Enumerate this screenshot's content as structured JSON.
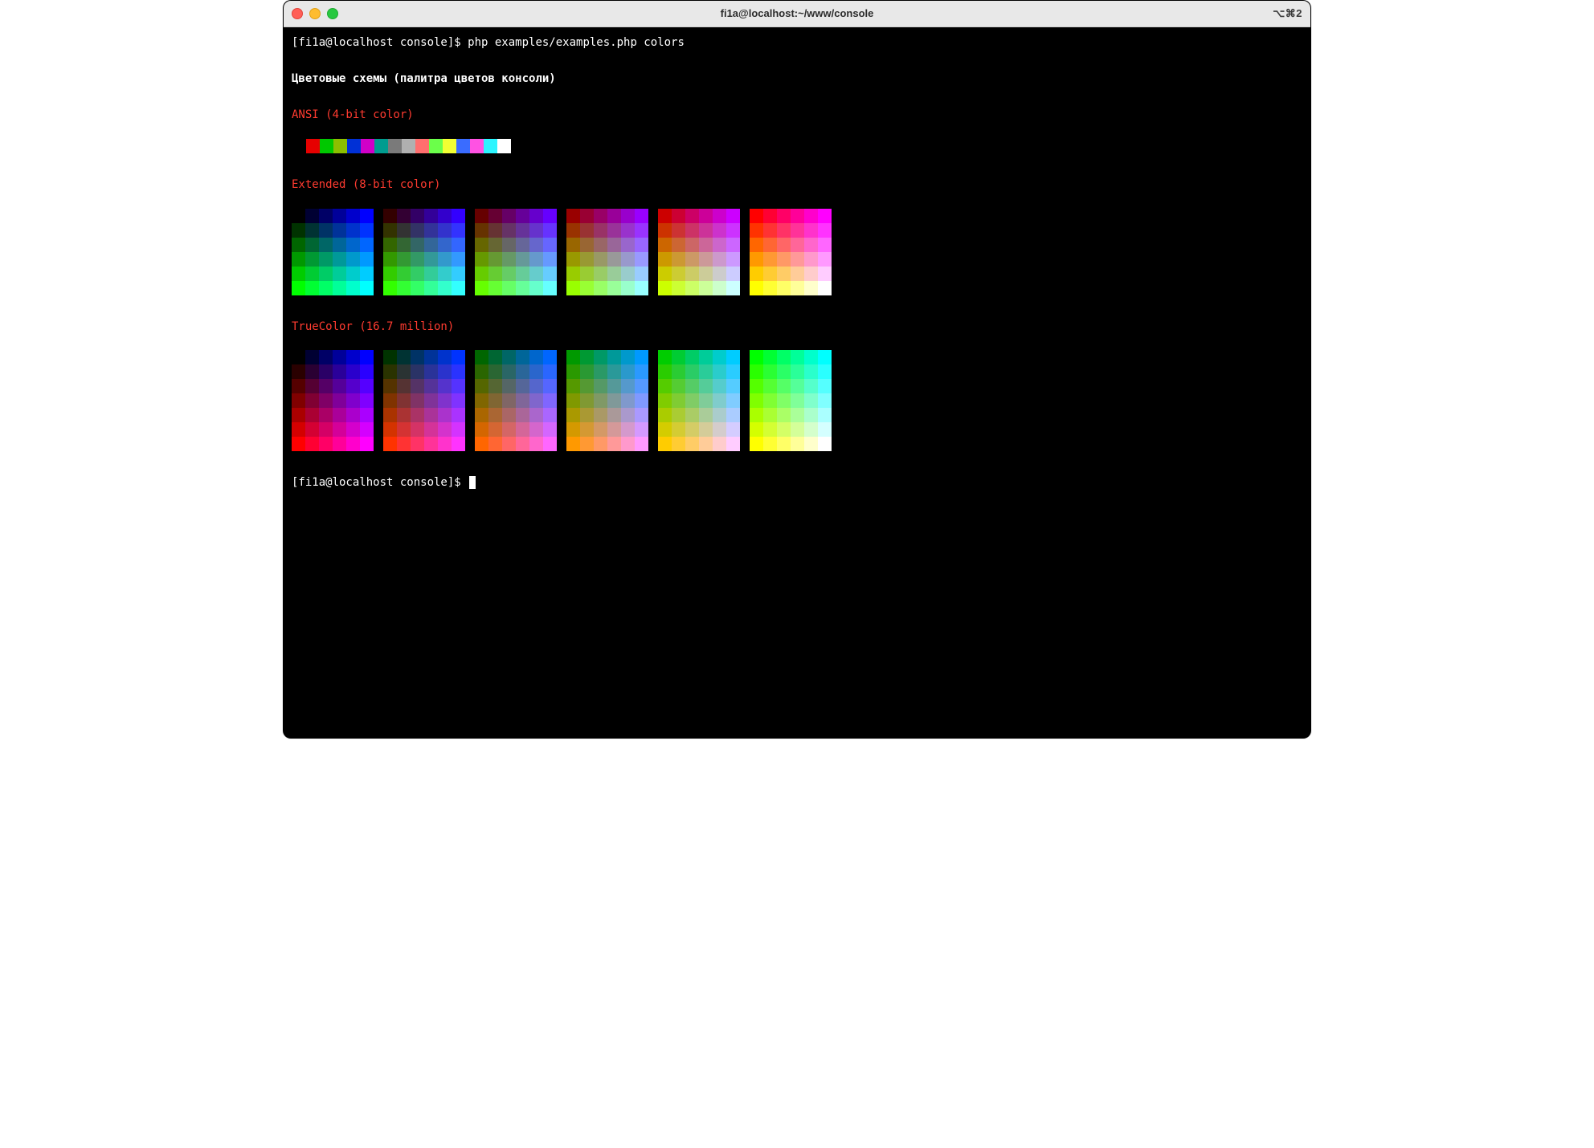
{
  "titlebar": {
    "title": "fi1a@localhost:~/www/console",
    "tab_indicator": "⌥⌘2"
  },
  "term": {
    "prompt": "[fi1a@localhost console]$ ",
    "command": "php examples/examples.php colors",
    "heading_bold": "Цветовые схемы (палитра цветов консоли)",
    "section_ansi": "ANSI (4-bit color)",
    "section_extended": "Extended (8-bit color)",
    "section_truecolor": "TrueColor (16.7 million)",
    "prompt2": "[fi1a@localhost console]$ "
  },
  "ansi_colors": [
    "#e60000",
    "#00c800",
    "#8bbf00",
    "#0030d6",
    "#d000c8",
    "#009c8f",
    "#7a7a7a",
    "#b0b0b0",
    "#ff6e6e",
    "#6bff4a",
    "#f2ff33",
    "#3a6cff",
    "#ff52e3",
    "#2bf5ff",
    "#ffffff"
  ],
  "ext_levels": [
    0,
    51,
    102,
    153,
    204,
    255
  ],
  "true_levels": [
    0,
    42,
    85,
    128,
    170,
    212,
    255
  ]
}
